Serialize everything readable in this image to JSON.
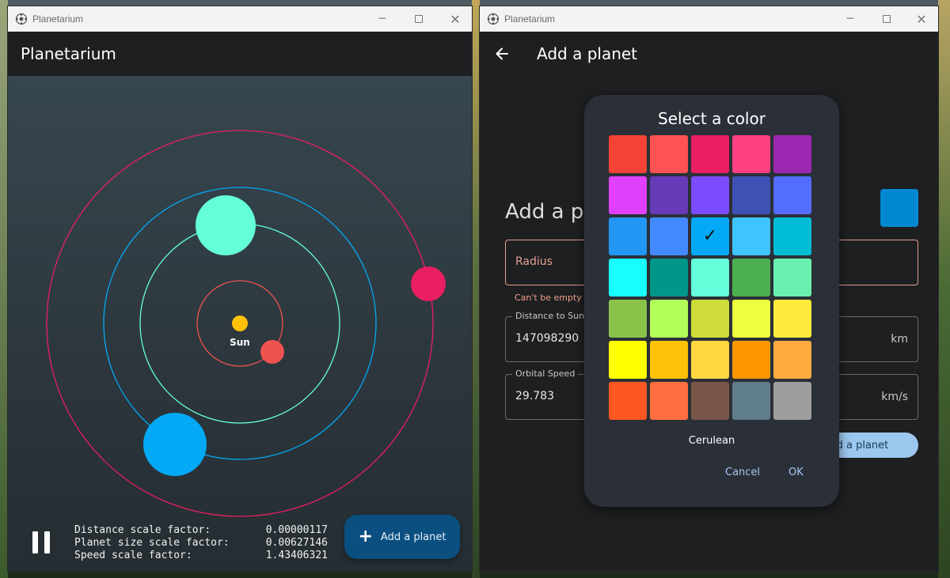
{
  "left_window": {
    "title": "Planetarium",
    "appbar_title": "Planetarium",
    "sun_label": "Sun",
    "scale": [
      {
        "label": "Distance scale factor:",
        "value": "0.00000117"
      },
      {
        "label": "Planet size scale factor:",
        "value": "0.00627146"
      },
      {
        "label": "Speed scale factor:",
        "value": "1.43406321"
      }
    ],
    "add_button_label": "Add a planet",
    "colors": {
      "sun": "#ffc107",
      "orbit_1": "#ef5350",
      "orbit_2": "#64ffda",
      "orbit_3": "#03a9f4",
      "orbit_4": "#e91e63",
      "planet_1": "#ef5350",
      "planet_2": "#64ffda",
      "planet_3": "#03a9f4",
      "planet_4": "#e91e63"
    }
  },
  "right_window": {
    "title": "Planetarium",
    "appbar_title": "Add a planet",
    "form_heading": "Add a pl",
    "selected_color": "#0288d1",
    "radius": {
      "placeholder": "Radius",
      "error": "Can't be empty"
    },
    "distance": {
      "label": "Distance to Sun",
      "value": "147098290",
      "unit": "km"
    },
    "speed": {
      "label": "Orbital Speed",
      "value": "29.783",
      "unit": "km/s"
    },
    "submit_label": "Add a planet"
  },
  "dialog": {
    "title": "Select a color",
    "selected_name": "Cerulean",
    "cancel_label": "Cancel",
    "ok_label": "OK",
    "selected_index": 12,
    "colors": [
      "#f44336",
      "#ff5252",
      "#e91e63",
      "#ff4081",
      "#9c27b0",
      "#e040fb",
      "#673ab7",
      "#7c4dff",
      "#3f51b5",
      "#536dfe",
      "#2196f3",
      "#448aff",
      "#03a9f4",
      "#40c4ff",
      "#00bcd4",
      "#18ffff",
      "#009688",
      "#64ffda",
      "#4caf50",
      "#69f0ae",
      "#8bc34a",
      "#b2ff59",
      "#cddc39",
      "#eeff41",
      "#ffeb3b",
      "#ffff00",
      "#ffc107",
      "#ffd740",
      "#ff9800",
      "#ffab40",
      "#ff5722",
      "#ff6e40",
      "#795548",
      "#607d8b",
      "#9e9e9e"
    ]
  }
}
